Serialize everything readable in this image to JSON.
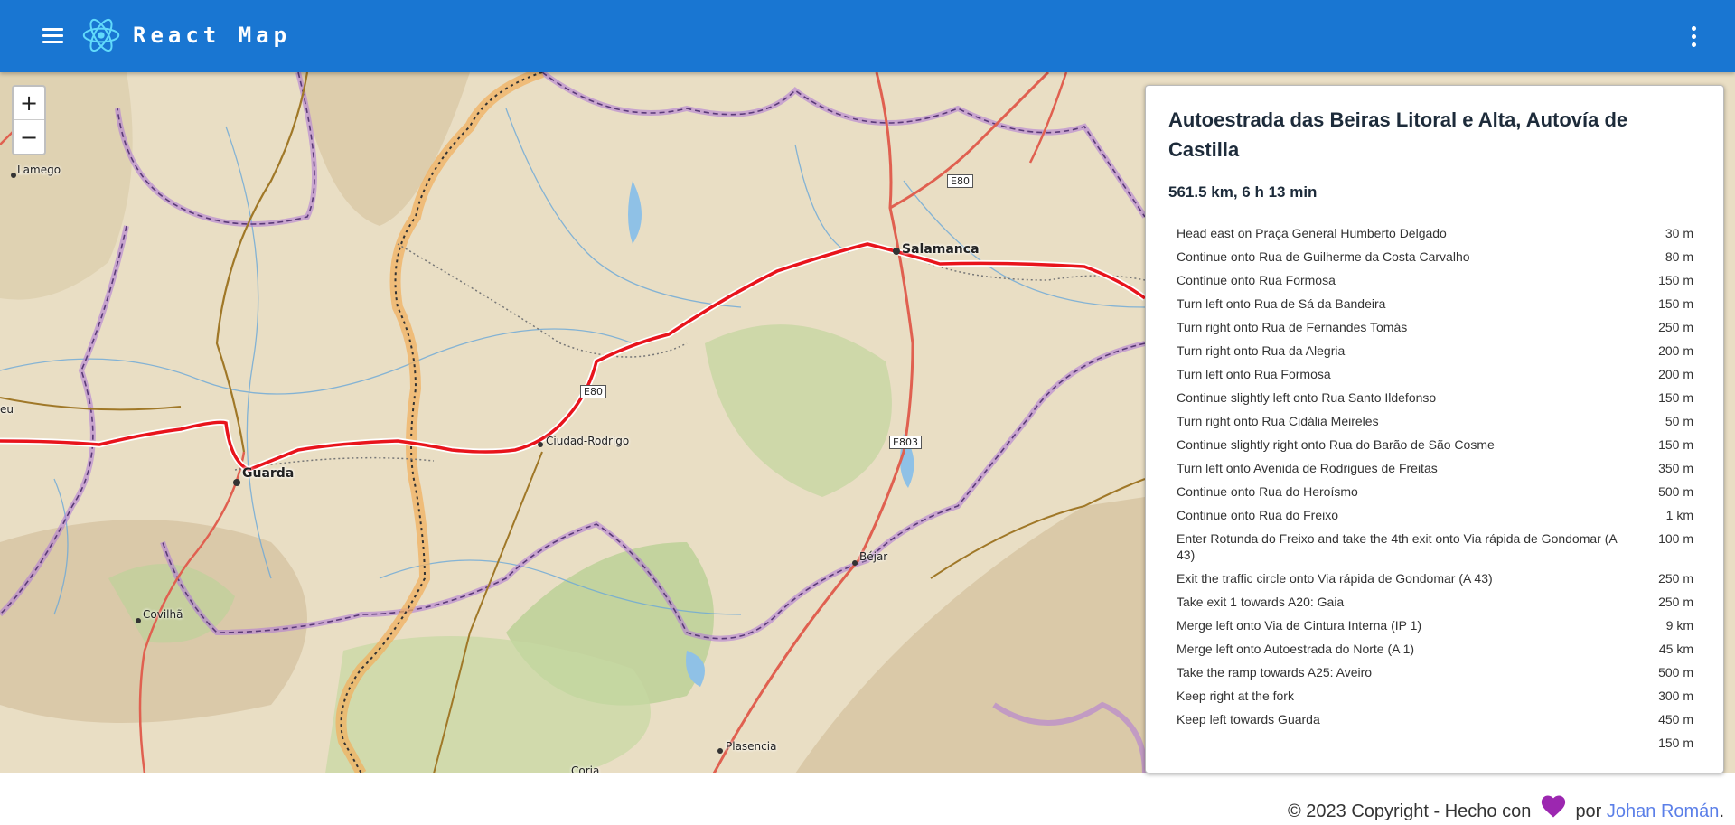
{
  "header": {
    "menu_icon": "hamburger-menu-icon",
    "logo_icon": "react-atom-icon",
    "title": "React Map",
    "more_icon": "more-vert-icon",
    "color": "#1976d2"
  },
  "map": {
    "zoom_in_label": "+",
    "zoom_out_label": "−",
    "places": {
      "lamego": "Lamego",
      "salamanca": "Salamanca",
      "guarda": "Guarda",
      "ciudad_rodrigo": "Ciudad-Rodrigo",
      "covilha": "Covilhã",
      "bejar": "Béjar",
      "plasencia": "Plasencia",
      "coria": "Coria",
      "left_edge": "eu"
    },
    "road_shields": {
      "e80_top": "E80",
      "e80_mid": "E80",
      "e803": "E803"
    },
    "route_color": "#e8141c"
  },
  "directions": {
    "title": "Autoestrada das Beiras Litoral e Alta, Autovía de Castilla",
    "summary": "561.5 km, 6 h 13 min",
    "steps": [
      {
        "instruction": "Head east on Praça General Humberto Delgado",
        "distance": "30 m"
      },
      {
        "instruction": "Continue onto Rua de Guilherme da Costa Carvalho",
        "distance": "80 m"
      },
      {
        "instruction": "Continue onto Rua Formosa",
        "distance": "150 m"
      },
      {
        "instruction": "Turn left onto Rua de Sá da Bandeira",
        "distance": "150 m"
      },
      {
        "instruction": "Turn right onto Rua de Fernandes Tomás",
        "distance": "250 m"
      },
      {
        "instruction": "Turn right onto Rua da Alegria",
        "distance": "200 m"
      },
      {
        "instruction": "Turn left onto Rua Formosa",
        "distance": "200 m"
      },
      {
        "instruction": "Continue slightly left onto Rua Santo Ildefonso",
        "distance": "150 m"
      },
      {
        "instruction": "Turn right onto Rua Cidália Meireles",
        "distance": "50 m"
      },
      {
        "instruction": "Continue slightly right onto Rua do Barão de São Cosme",
        "distance": "150 m"
      },
      {
        "instruction": "Turn left onto Avenida de Rodrigues de Freitas",
        "distance": "350 m"
      },
      {
        "instruction": "Continue onto Rua do Heroísmo",
        "distance": "500 m"
      },
      {
        "instruction": "Continue onto Rua do Freixo",
        "distance": "1 km"
      },
      {
        "instruction": "Enter Rotunda do Freixo and take the 4th exit onto Via rápida de Gondomar (A 43)",
        "distance": "100 m"
      },
      {
        "instruction": "Exit the traffic circle onto Via rápida de Gondomar (A 43)",
        "distance": "250 m"
      },
      {
        "instruction": "Take exit 1 towards A20: Gaia",
        "distance": "250 m"
      },
      {
        "instruction": "Merge left onto Via de Cintura Interna (IP 1)",
        "distance": "9 km"
      },
      {
        "instruction": "Merge left onto Autoestrada do Norte (A 1)",
        "distance": "45 km"
      },
      {
        "instruction": "Take the ramp towards A25: Aveiro",
        "distance": "500 m"
      },
      {
        "instruction": "Keep right at the fork",
        "distance": "300 m"
      },
      {
        "instruction": "Keep left towards Guarda",
        "distance": "450 m"
      },
      {
        "instruction": "",
        "distance": "150 m"
      }
    ]
  },
  "footer": {
    "copyright": "© 2023 Copyright - Hecho con",
    "heart_icon": "purple-heart-icon",
    "por": "por",
    "author": "Johan Román",
    "period": "."
  }
}
